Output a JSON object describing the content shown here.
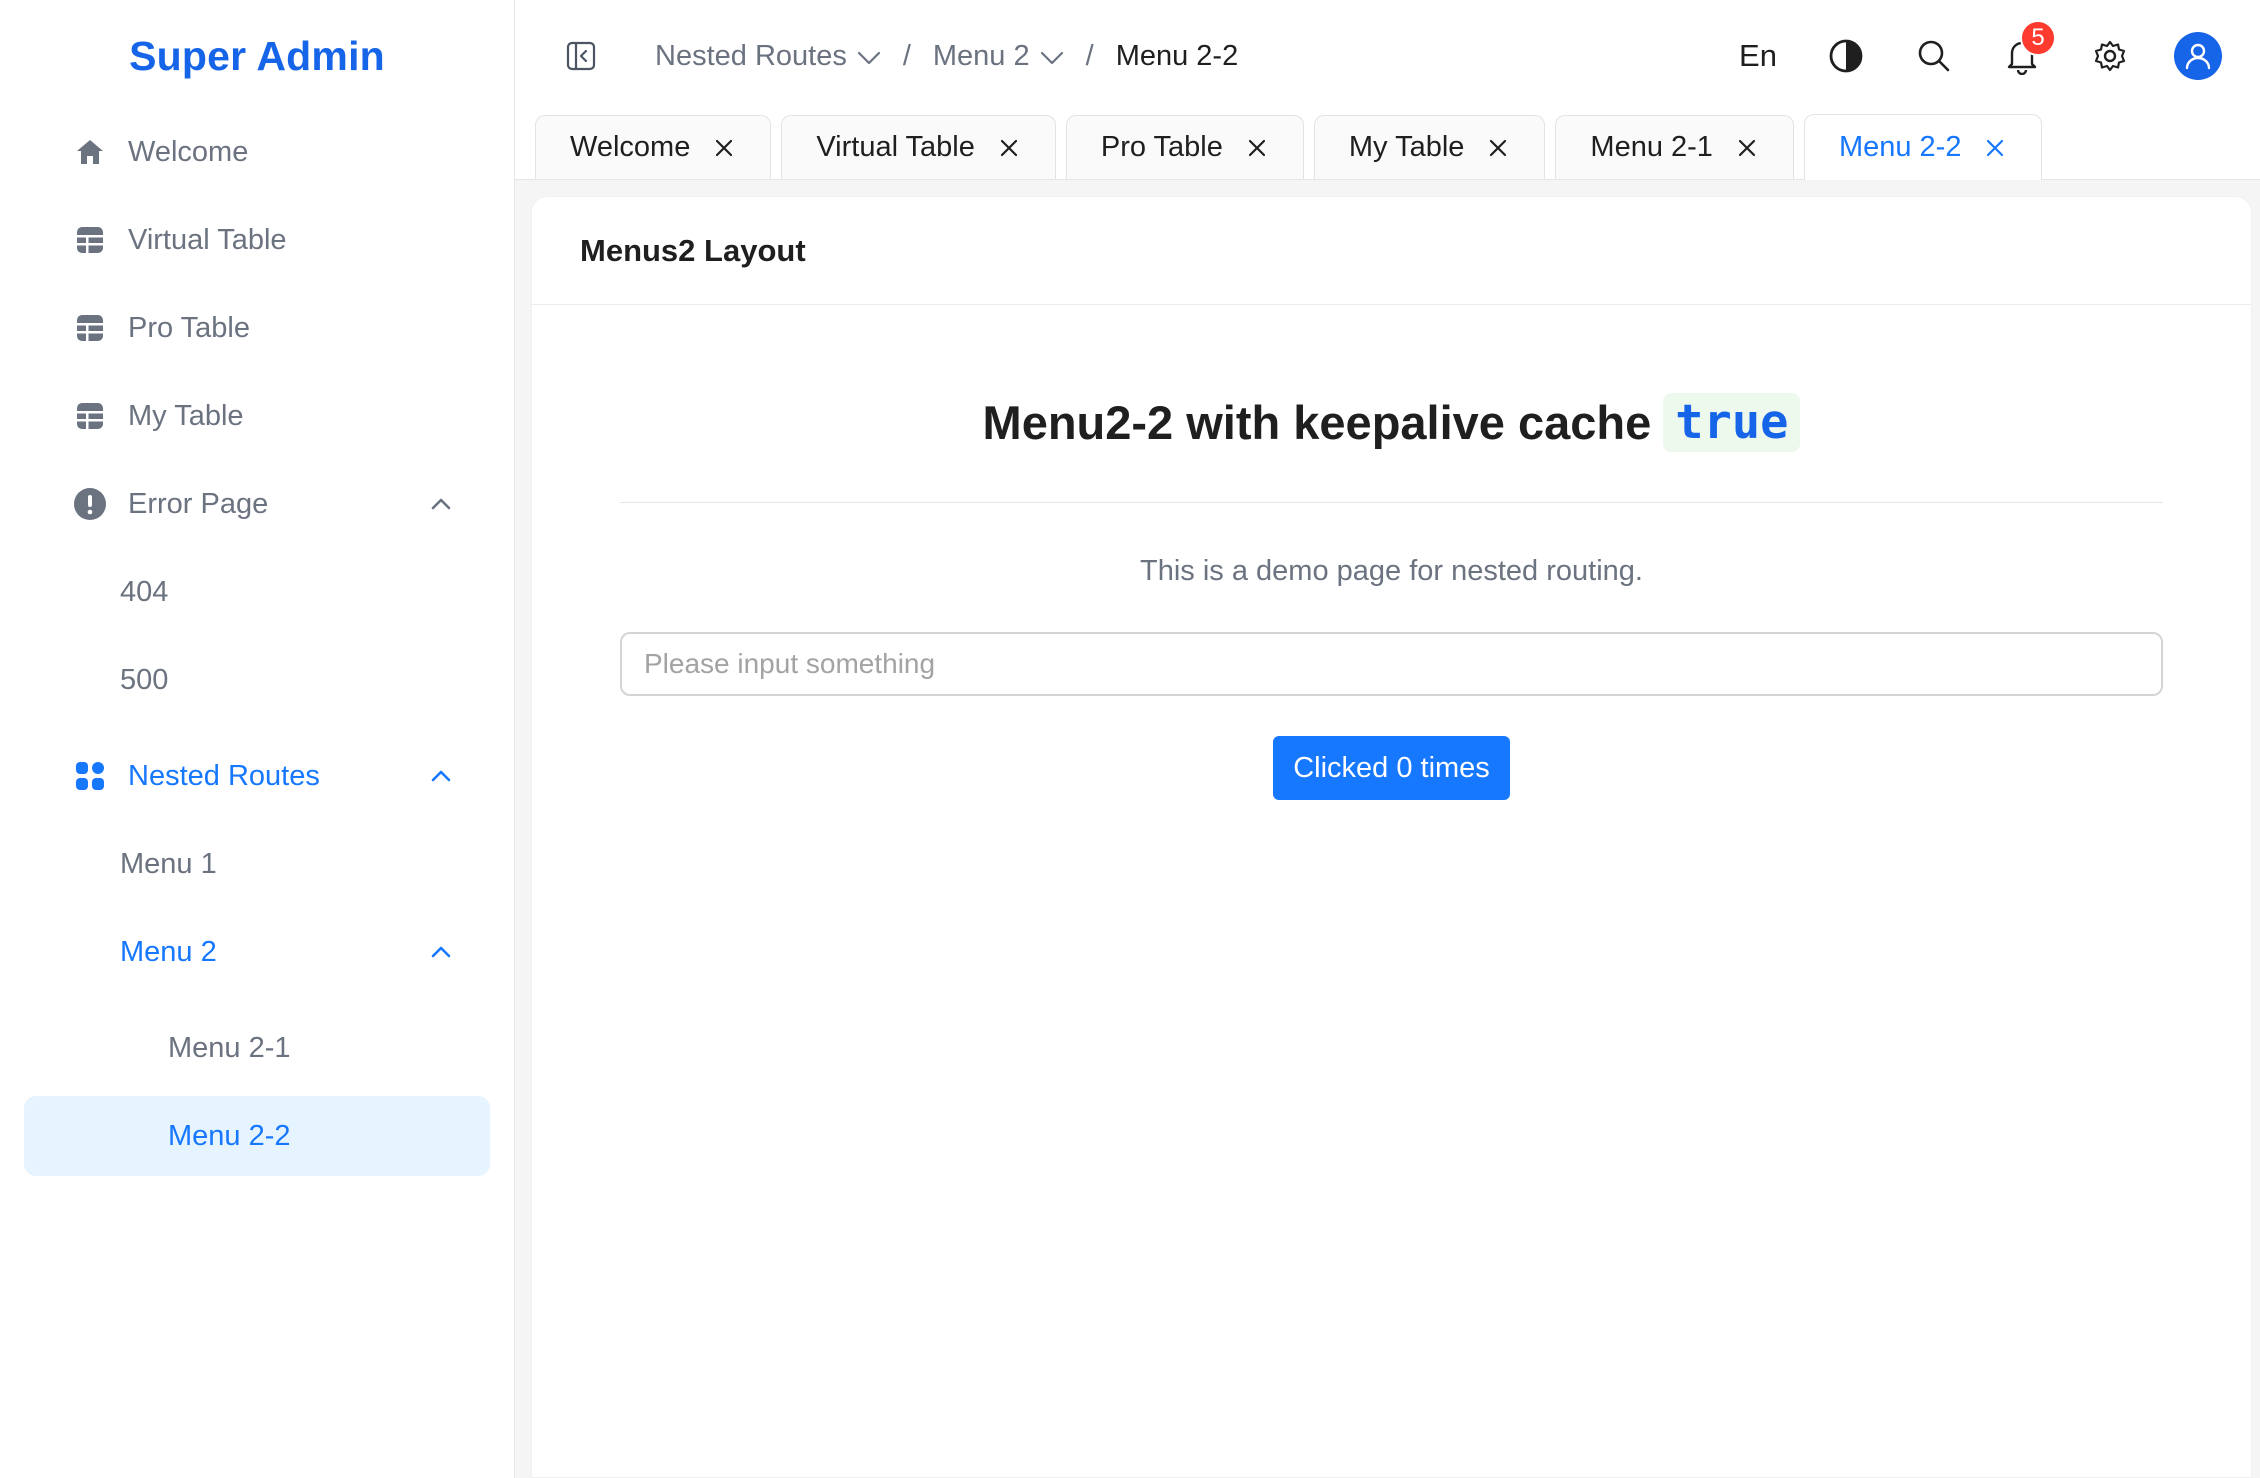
{
  "app": {
    "title": "Super Admin"
  },
  "sidebar": {
    "items": [
      {
        "label": "Welcome",
        "icon": "home-icon"
      },
      {
        "label": "Virtual Table",
        "icon": "table-icon"
      },
      {
        "label": "Pro Table",
        "icon": "table-icon"
      },
      {
        "label": "My Table",
        "icon": "table-icon"
      },
      {
        "label": "Error Page",
        "icon": "exclamation-icon",
        "expanded": true,
        "children": [
          {
            "label": "404"
          },
          {
            "label": "500"
          }
        ]
      },
      {
        "label": "Nested Routes",
        "icon": "grid-icon",
        "expanded": true,
        "active": true,
        "children": [
          {
            "label": "Menu 1"
          },
          {
            "label": "Menu 2",
            "expanded": true,
            "active": true,
            "children": [
              {
                "label": "Menu 2-1"
              },
              {
                "label": "Menu 2-2",
                "selected": true
              }
            ]
          }
        ]
      }
    ]
  },
  "header": {
    "breadcrumb": [
      {
        "label": "Nested Routes"
      },
      {
        "label": "Menu 2"
      },
      {
        "label": "Menu 2-2"
      }
    ],
    "separator": "/",
    "language": "En",
    "notification_count": "5"
  },
  "tabs": [
    {
      "label": "Welcome"
    },
    {
      "label": "Virtual Table"
    },
    {
      "label": "Pro Table"
    },
    {
      "label": "My Table"
    },
    {
      "label": "Menu 2-1"
    },
    {
      "label": "Menu 2-2",
      "active": true
    }
  ],
  "main": {
    "card_title": "Menus2 Layout",
    "heading_text": "Menu2-2 with keepalive cache",
    "heading_code": "true",
    "description": "This is a demo page for nested routing.",
    "input": {
      "placeholder": "Please input something",
      "value": ""
    },
    "button_label": "Clicked 0 times"
  },
  "colors": {
    "accent": "#1677ff",
    "brand": "#1664e8",
    "selected_bg": "#e6f4ff",
    "badge": "#ff3b30"
  }
}
